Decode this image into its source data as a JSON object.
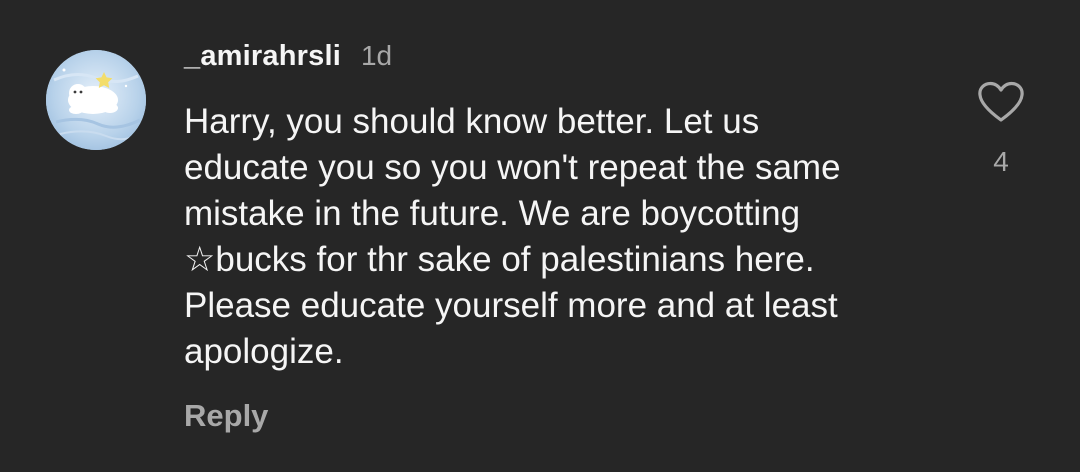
{
  "comment": {
    "username": "_amirahrsli",
    "time": "1d",
    "text_lines": [
      "Harry, you should know better. Let us",
      "educate you so you won't repeat the same",
      "mistake in the future. We are boycotting",
      "☆bucks for thr sake of palestinians here.",
      "Please educate yourself more and at least",
      "apologize."
    ],
    "reply_label": "Reply",
    "like_count": "4",
    "like_icon": "heart-outline-icon"
  },
  "colors": {
    "background": "#262626",
    "primary_text": "#f5f5f5",
    "secondary_text": "#a8a8a8"
  }
}
